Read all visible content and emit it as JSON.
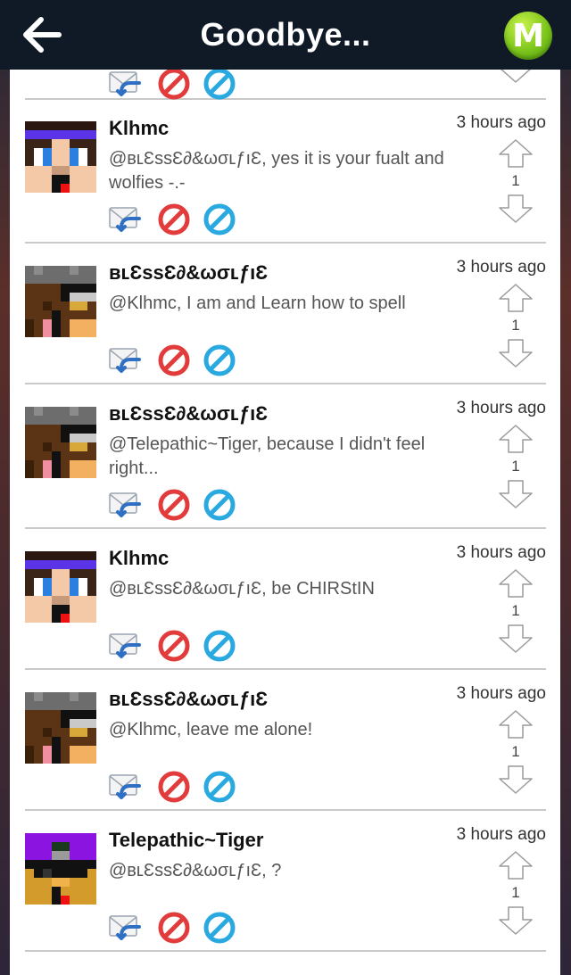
{
  "header": {
    "title": "Goodbye...",
    "back_icon": "arrow-left-icon",
    "logo_letter": "M",
    "logo_color": "#7cc51c"
  },
  "colors": {
    "bar_bg": "#101a27",
    "ban_red": "#e23b3b",
    "block_blue": "#2aa9e0",
    "reply_blue": "#2f6fc4"
  },
  "comments": [
    {
      "user": "Klhmc",
      "time": "3 hours ago",
      "text": "@ʙʟƐssƐ∂&ωσʟƒıƐ, yes it is your fualt and wolfies -.-",
      "votes": "1",
      "avatar": "avatar-blue-headband"
    },
    {
      "user": "ʙʟƐssƐ∂&ωσʟƒıƐ",
      "time": "3 hours ago",
      "text": "@Klhmc, I am and Learn how to spell",
      "votes": "1",
      "avatar": "avatar-grey-wolf"
    },
    {
      "user": "ʙʟƐssƐ∂&ωσʟƒıƐ",
      "time": "3 hours ago",
      "text": "@Telepathic~Tiger, because I didn't feel right...",
      "votes": "1",
      "avatar": "avatar-grey-wolf"
    },
    {
      "user": "Klhmc",
      "time": "3 hours ago",
      "text": "@ʙʟƐssƐ∂&ωσʟƒıƐ, be CHIRStIN",
      "votes": "1",
      "avatar": "avatar-blue-headband"
    },
    {
      "user": "ʙʟƐssƐ∂&ωσʟƒıƐ",
      "time": "3 hours ago",
      "text": "@Klhmc, leave me alone!",
      "votes": "1",
      "avatar": "avatar-grey-wolf"
    },
    {
      "user": "Telepathic~Tiger",
      "time": "3 hours ago",
      "text": "@ʙʟƐssƐ∂&ωσʟƒıƐ, ?",
      "votes": "1",
      "avatar": "avatar-purple-tiger"
    }
  ],
  "icons": {
    "reply": "reply-mail-icon",
    "ban": "ban-icon",
    "block": "block-icon",
    "up": "vote-up-arrow-icon",
    "down": "vote-down-arrow-icon"
  }
}
